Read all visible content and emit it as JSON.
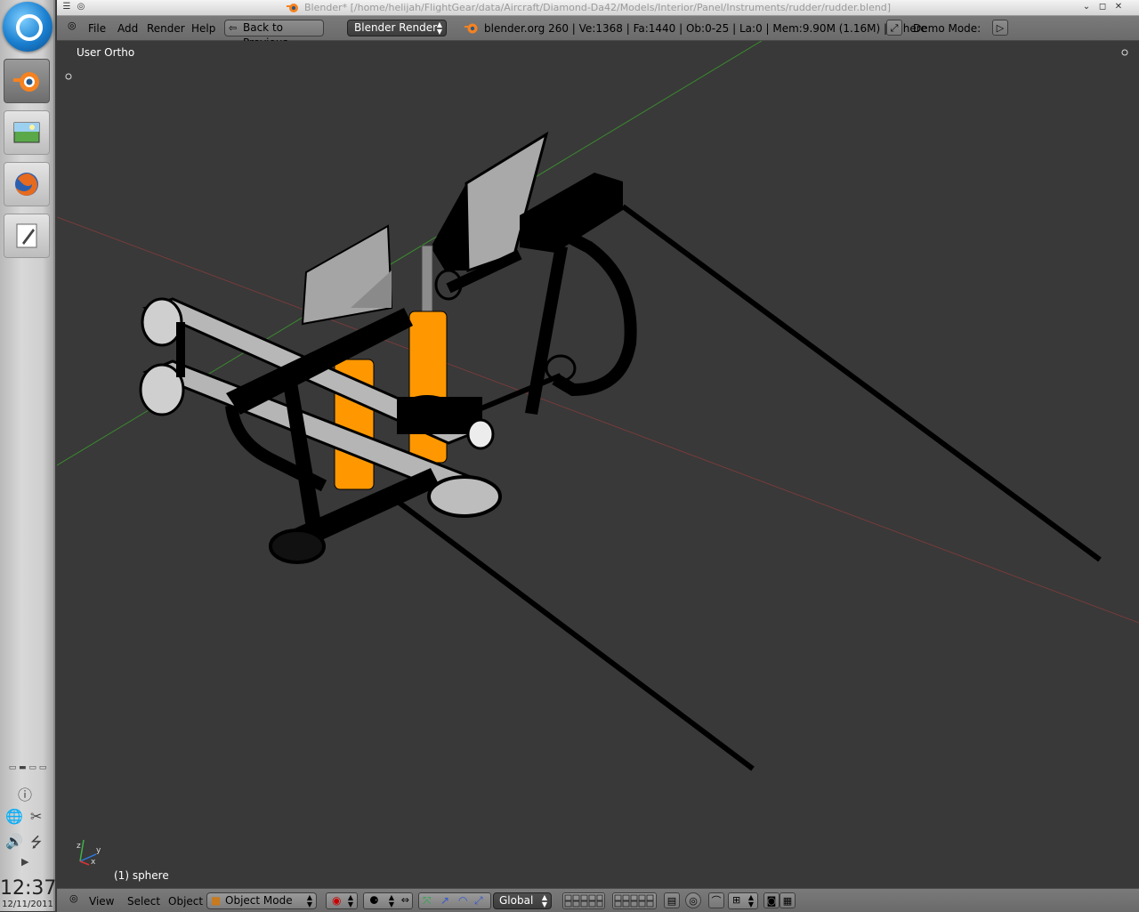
{
  "window": {
    "title": "Blender* [/home/helijah/FlightGear/data/Aircraft/Diamond-Da42/Models/Interior/Panel/Instruments/rudder/rudder.blend]"
  },
  "header": {
    "menus": [
      "File",
      "Add",
      "Render",
      "Help"
    ],
    "back_button": "Back to Previous",
    "render_engine": "Blender Render",
    "stats": "blender.org 260 | Ve:1368 | Fa:1440 | Ob:0-25 | La:0 | Mem:9.90M (1.16M) | sphere",
    "demo_mode_label": "Demo Mode:"
  },
  "viewport": {
    "view_name": "User Ortho",
    "active_object_label": "(1) sphere",
    "axis_labels": {
      "x": "x",
      "y": "y",
      "z": "z"
    }
  },
  "footer": {
    "menus": [
      "View",
      "Select",
      "Object"
    ],
    "mode": "Object Mode",
    "orientation": "Global"
  },
  "dock": {
    "clock": "12:37",
    "date": "12/11/2011"
  },
  "colors": {
    "viewport_bg": "#393939",
    "header_bg": "#727272",
    "orange": "#ff9800",
    "grid_red": "#8a3a3a",
    "grid_green": "#3b8a2f"
  }
}
